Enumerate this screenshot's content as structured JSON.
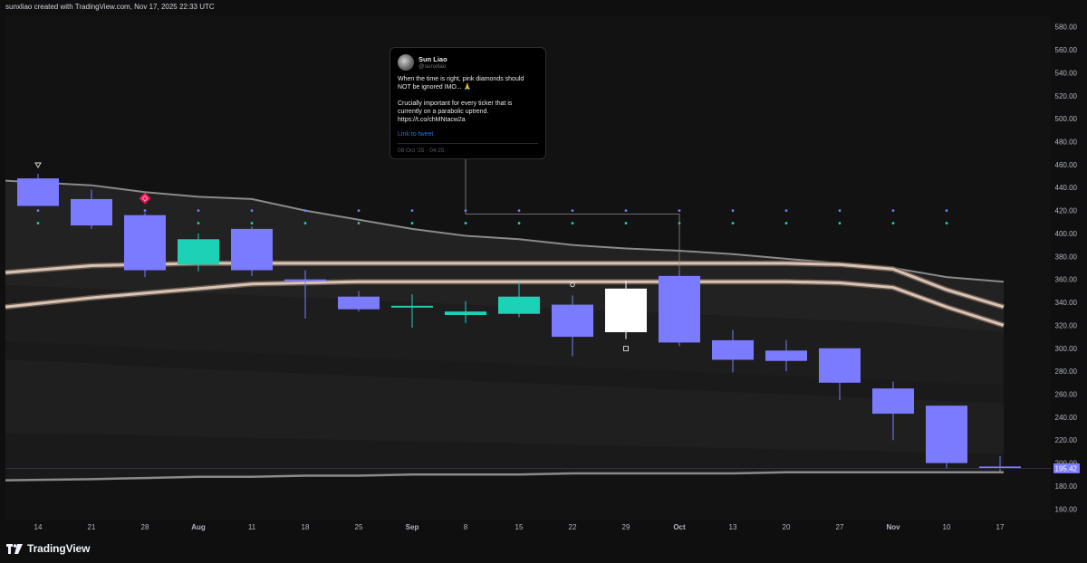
{
  "header": {
    "credit": "sunxliao created with TradingView.com, Nov 17, 2025 22:33 UTC"
  },
  "branding": {
    "logo_text": "TradingView"
  },
  "tweet": {
    "author_name": "Sun Liao",
    "author_handle": "@sunxliao",
    "body_line1": "When the time is right, pink diamonds should NOT be ignored IMO... 🙏",
    "body_line2": "Crucially important for every ticker that is currently on a parabolic uptrend.\nhttps://t.co/chMNtacw2a",
    "link_label": "Link to tweet",
    "date": "08 Oct '25 · 04:25"
  },
  "colors": {
    "background": "#0f0f0f",
    "bearish_candle": "#7b7bff",
    "bullish_candle": "#1dd1b6",
    "highlight_candle": "#ffffff",
    "band_fill": "#2a2a2a",
    "band_line": "#8a8a8a",
    "ma_ribbon": "#d8c3b5",
    "pink_diamond": "#e8195a",
    "dot_blue": "#6f7dff",
    "dot_teal": "#1dd1b6",
    "price_label_bg": "#7b7bff"
  },
  "chart_data": {
    "type": "candlestick",
    "timeframe": "weekly",
    "y_range": [
      150,
      590
    ],
    "y_ticks": [
      160,
      180,
      200,
      220,
      240,
      260,
      280,
      300,
      320,
      340,
      360,
      380,
      400,
      420,
      440,
      460,
      480,
      500,
      520,
      540,
      560,
      580
    ],
    "y_tick_labels": [
      "160.00",
      "180.00",
      "200.00",
      "220.00",
      "240.00",
      "260.00",
      "280.00",
      "300.00",
      "320.00",
      "340.00",
      "360.00",
      "380.00",
      "400.00",
      "420.00",
      "440.00",
      "460.00",
      "480.00",
      "500.00",
      "520.00",
      "540.00",
      "560.00",
      "580.00"
    ],
    "x_labels": [
      "14",
      "21",
      "28",
      "Aug",
      "11",
      "18",
      "25",
      "Sep",
      "8",
      "15",
      "22",
      "29",
      "Oct",
      "13",
      "20",
      "27",
      "Nov",
      "10",
      "17"
    ],
    "x_label_bold": [
      false,
      false,
      false,
      true,
      false,
      false,
      false,
      true,
      false,
      false,
      false,
      false,
      true,
      false,
      false,
      false,
      true,
      false,
      false
    ],
    "last_price": 195.42,
    "last_price_label": "195.42",
    "candles": [
      {
        "o": 424,
        "h": 452,
        "l": 424,
        "c": 448,
        "color": "bearish"
      },
      {
        "o": 430,
        "h": 438,
        "l": 404,
        "c": 407,
        "color": "bearish"
      },
      {
        "o": 416,
        "h": 418,
        "l": 362,
        "c": 368,
        "color": "bearish"
      },
      {
        "o": 373,
        "h": 400,
        "l": 367,
        "c": 395,
        "color": "bullish"
      },
      {
        "o": 404,
        "h": 406,
        "l": 363,
        "c": 368,
        "color": "bearish"
      },
      {
        "o": 359,
        "h": 368,
        "l": 326,
        "c": 360,
        "color": "bearish"
      },
      {
        "o": 345,
        "h": 350,
        "l": 332,
        "c": 334,
        "color": "bearish"
      },
      {
        "o": 337,
        "h": 347,
        "l": 318,
        "c": 336,
        "color": "bullish"
      },
      {
        "o": 329,
        "h": 341,
        "l": 322,
        "c": 332,
        "color": "bullish"
      },
      {
        "o": 330,
        "h": 358,
        "l": 327,
        "c": 345,
        "color": "bullish"
      },
      {
        "o": 338,
        "h": 346,
        "l": 293,
        "c": 310,
        "color": "bearish"
      },
      {
        "o": 352,
        "h": 359,
        "l": 308,
        "c": 314,
        "color": "highlight"
      },
      {
        "o": 363,
        "h": 368,
        "l": 302,
        "c": 305,
        "color": "bearish"
      },
      {
        "o": 307,
        "h": 316,
        "l": 279,
        "c": 290,
        "color": "bearish"
      },
      {
        "o": 298,
        "h": 307,
        "l": 280,
        "c": 289,
        "color": "bearish"
      },
      {
        "o": 300,
        "h": 300,
        "l": 255,
        "c": 270,
        "color": "bearish"
      },
      {
        "o": 265,
        "h": 271,
        "l": 220,
        "c": 243,
        "color": "bearish"
      },
      {
        "o": 250,
        "h": 250,
        "l": 195,
        "c": 200,
        "color": "bearish"
      },
      {
        "o": 197,
        "h": 206,
        "l": 193,
        "c": 195.42,
        "color": "bearish"
      }
    ],
    "series": [
      {
        "name": "",
        "role": "band_upper",
        "values": [
          446,
          442,
          436,
          432,
          430,
          420,
          412,
          404,
          398,
          395,
          390,
          387,
          385,
          382,
          378,
          374,
          370,
          362,
          358
        ]
      },
      {
        "name": "",
        "role": "band_lower",
        "values": [
          185,
          186,
          187,
          188,
          188,
          189,
          189,
          190,
          190,
          190,
          191,
          191,
          191,
          191,
          192,
          192,
          192,
          192,
          192
        ]
      },
      {
        "name": "",
        "role": "ma_ribbon_upper",
        "values": [
          366,
          372,
          373,
          374,
          374,
          374,
          374,
          374,
          374,
          374,
          374,
          374,
          374,
          374,
          374,
          373,
          369,
          351,
          336
        ]
      },
      {
        "name": "",
        "role": "ma_ribbon_lower",
        "values": [
          336,
          344,
          348,
          352,
          356,
          357,
          358,
          358,
          358,
          358,
          358,
          358,
          358,
          358,
          358,
          357,
          353,
          336,
          320
        ]
      },
      {
        "name": "",
        "role": "inner_band_upper",
        "values": [
          355,
          352,
          350,
          348,
          346,
          344,
          342,
          340,
          338,
          336,
          334,
          332,
          330,
          328,
          326,
          324,
          322,
          318,
          314
        ]
      },
      {
        "name": "",
        "role": "inner_band_lower",
        "values": [
          306,
          303,
          300,
          298,
          296,
          294,
          292,
          290,
          288,
          286,
          284,
          282,
          280,
          278,
          276,
          274,
          272,
          270,
          268
        ]
      },
      {
        "name": "",
        "role": "outer_band_upper",
        "values": [
          290,
          287,
          284,
          282,
          280,
          278,
          276,
          274,
          272,
          270,
          268,
          266,
          264,
          262,
          260,
          258,
          256,
          254,
          252
        ]
      },
      {
        "name": "",
        "role": "outer_band_lower",
        "values": [
          226,
          225,
          224,
          223,
          222,
          221,
          220,
          219,
          218,
          217,
          216,
          215,
          214,
          213,
          212,
          211,
          210,
          209,
          208
        ]
      }
    ],
    "markers": {
      "pink_diamond_index": 2,
      "top_triangle_index": 0,
      "circle_marker_index": 10,
      "square_marker_index": 11,
      "dot_row_blue_value": 420,
      "dot_row_teal_value": 409,
      "dot_start_index": 0,
      "tweet_connector_from_index": 8,
      "tweet_connector_to_index": 12,
      "tweet_connector_value": 417
    }
  }
}
